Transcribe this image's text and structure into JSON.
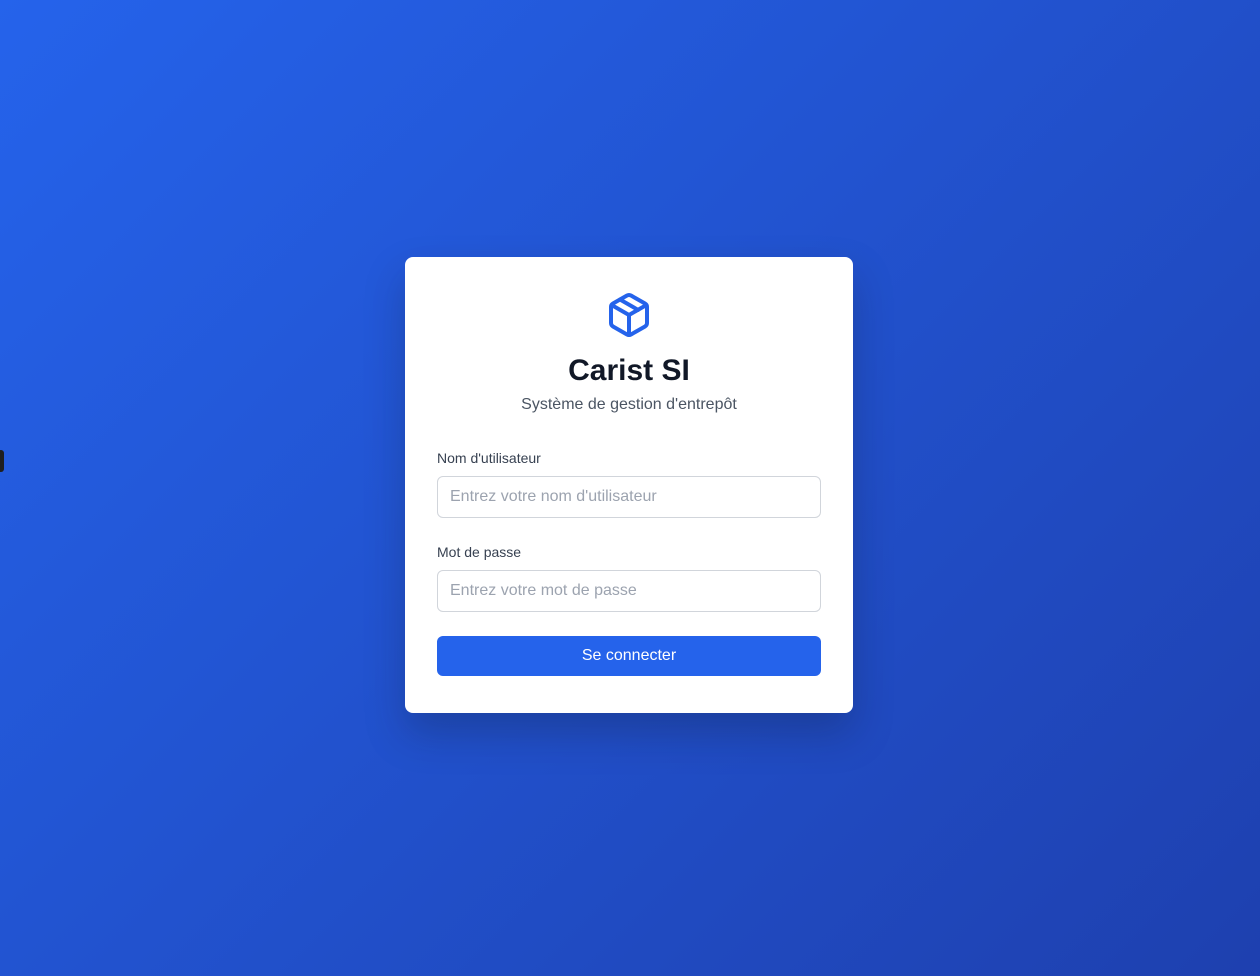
{
  "app": {
    "logo_icon": "package-box-icon",
    "title": "Carist SI",
    "subtitle": "Système de gestion d'entrepôt"
  },
  "form": {
    "username": {
      "label": "Nom d'utilisateur",
      "value": "",
      "placeholder": "Entrez votre nom d'utilisateur"
    },
    "password": {
      "label": "Mot de passe",
      "value": "",
      "placeholder": "Entrez votre mot de passe"
    },
    "submit_label": "Se connecter"
  },
  "colors": {
    "background_start": "#2563eb",
    "background_end": "#1e40af",
    "accent": "#2563eb",
    "title": "#111827",
    "subtitle": "#4b5563"
  }
}
